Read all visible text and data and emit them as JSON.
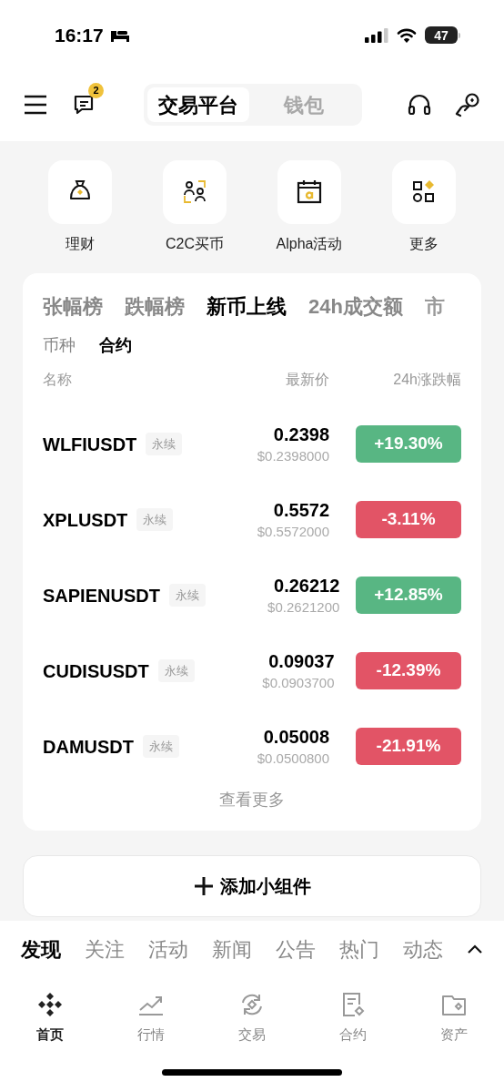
{
  "status_bar": {
    "time": "16:17",
    "battery": "47"
  },
  "header": {
    "message_badge": "2",
    "segments": [
      {
        "label": "交易平台",
        "selected": true
      },
      {
        "label": "钱包",
        "selected": false
      }
    ]
  },
  "shortcuts": [
    {
      "kind": "bag",
      "label": "理财"
    },
    {
      "kind": "people",
      "label": "C2C买币"
    },
    {
      "kind": "calendar",
      "label": "Alpha活动"
    },
    {
      "kind": "grid",
      "label": "更多"
    }
  ],
  "market": {
    "tabs": [
      {
        "label": "张幅榜",
        "selected": false
      },
      {
        "label": "跌幅榜",
        "selected": false
      },
      {
        "label": "新币上线",
        "selected": true
      },
      {
        "label": "24h成交额",
        "selected": false
      },
      {
        "label": "市",
        "selected": false
      }
    ],
    "subtabs": [
      {
        "label": "币种",
        "selected": false
      },
      {
        "label": "合约",
        "selected": true
      }
    ],
    "columns": [
      "名称",
      "最新价",
      "24h涨跌幅"
    ],
    "rows": [
      {
        "symbol": "WLFIUSDT",
        "tag": "永续",
        "price": "0.2398",
        "usd": "$0.2398000",
        "change": "+19.30%",
        "color": "#58b683"
      },
      {
        "symbol": "XPLUSDT",
        "tag": "永续",
        "price": "0.5572",
        "usd": "$0.5572000",
        "change": "-3.11%",
        "color": "#e25466"
      },
      {
        "symbol": "SAPIENUSDT",
        "tag": "永续",
        "price": "0.26212",
        "usd": "$0.2621200",
        "change": "+12.85%",
        "color": "#58b683"
      },
      {
        "symbol": "CUDISUSDT",
        "tag": "永续",
        "price": "0.09037",
        "usd": "$0.0903700",
        "change": "-12.39%",
        "color": "#e25466"
      },
      {
        "symbol": "DAMUSDT",
        "tag": "永续",
        "price": "0.05008",
        "usd": "$0.0500800",
        "change": "-21.91%",
        "color": "#e25466"
      }
    ],
    "more": "查看更多"
  },
  "add_widget": "添加小组件",
  "feed_tabs": [
    {
      "label": "发现",
      "selected": true
    },
    {
      "label": "关注",
      "selected": false
    },
    {
      "label": "活动",
      "selected": false
    },
    {
      "label": "新闻",
      "selected": false
    },
    {
      "label": "公告",
      "selected": false
    },
    {
      "label": "热门",
      "selected": false
    },
    {
      "label": "动态",
      "selected": false
    }
  ],
  "bottom_nav": [
    {
      "kind": "home",
      "label": "首页",
      "selected": true
    },
    {
      "kind": "markets",
      "label": "行情",
      "selected": false
    },
    {
      "kind": "trade",
      "label": "交易",
      "selected": false
    },
    {
      "kind": "futures",
      "label": "合约",
      "selected": false
    },
    {
      "kind": "assets",
      "label": "资产",
      "selected": false
    }
  ]
}
